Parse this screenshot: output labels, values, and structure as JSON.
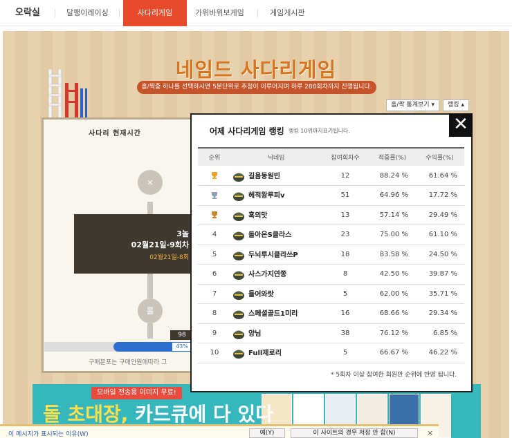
{
  "nav": {
    "home": "오락실",
    "items": [
      "달팽이레이싱",
      "사다리게임",
      "가위바위보게임",
      "게임게시판"
    ]
  },
  "game": {
    "title": "네임드 사다리게임",
    "subtitle": "홀/짝중 하나를 선택하시면 5분단위로 추첨이 이루어지며 하루 288회차까지 진행됩니다.",
    "stats_button": "홀/짝 통계보기",
    "ranking_button": "랭킹",
    "time_title": "사다리 현재시간",
    "round_line1": "3놀",
    "round_line2": "02월21일-9회차",
    "round_line3": "02월21일-8회",
    "node_top": "×",
    "node_bottom": "홀",
    "count_tag": "98",
    "progress_label": "43%",
    "progress_value": 0.43,
    "note": "구매분포는 구매인원에따라 그"
  },
  "popup": {
    "title": "어제 사다리게임 랭킹",
    "subtitle": "랭킹 10위까지표기됩니다.",
    "close": "✕",
    "columns": [
      "순위",
      "닉네임",
      "참여회차수",
      "적중률(%)",
      "수익률(%)"
    ],
    "rows": [
      {
        "rank": "",
        "medal": "gold",
        "name": "길음동원빈",
        "rounds": "12",
        "hit": "88.24 %",
        "profit": "61.64 %"
      },
      {
        "rank": "",
        "medal": "silver",
        "name": "헤적왕루피v",
        "rounds": "51",
        "hit": "64.96 %",
        "profit": "17.72 %"
      },
      {
        "rank": "",
        "medal": "bronze",
        "name": "혹의맛",
        "rounds": "13",
        "hit": "57.14 %",
        "profit": "29.49 %"
      },
      {
        "rank": "4",
        "medal": "",
        "name": "돌아온S클라스",
        "rounds": "23",
        "hit": "75.00 %",
        "profit": "61.10 %"
      },
      {
        "rank": "5",
        "medal": "",
        "name": "두뇌루시클라쓰P",
        "rounds": "18",
        "hit": "83.58 %",
        "profit": "24.50 %"
      },
      {
        "rank": "6",
        "medal": "",
        "name": "사스가지연쫑",
        "rounds": "8",
        "hit": "42.50 %",
        "profit": "39.87 %"
      },
      {
        "rank": "7",
        "medal": "",
        "name": "들어와랏",
        "rounds": "5",
        "hit": "62.00 %",
        "profit": "35.71 %"
      },
      {
        "rank": "8",
        "medal": "",
        "name": "스페셜골드1미리",
        "rounds": "16",
        "hit": "68.66 %",
        "profit": "29.34 %"
      },
      {
        "rank": "9",
        "medal": "",
        "name": "양님",
        "rounds": "38",
        "hit": "76.12 %",
        "profit": "6.85 %"
      },
      {
        "rank": "10",
        "medal": "",
        "name": "Full제로리",
        "rounds": "5",
        "hit": "66.67 %",
        "profit": "46.22 %"
      }
    ],
    "footnote": "* 5회차 이상 참여한 회원만 순위에 반영 됩니다."
  },
  "ad": {
    "tag": "모바일 전송용 이미지 무료!",
    "text_highlight": "돌 초대장,",
    "text_rest": " 카드큐에 다 있다"
  },
  "notification": {
    "link": "이 메시지가 표시되는 이유(W)",
    "yes_button": "예(Y)",
    "no_button": "이 사이트의 경우 저장 안 함(N)",
    "close": "×"
  },
  "colors": {
    "accent": "#e84b2c",
    "board": "#e7cfa8",
    "title": "#d8741e",
    "progress": "#2d6fd1"
  }
}
